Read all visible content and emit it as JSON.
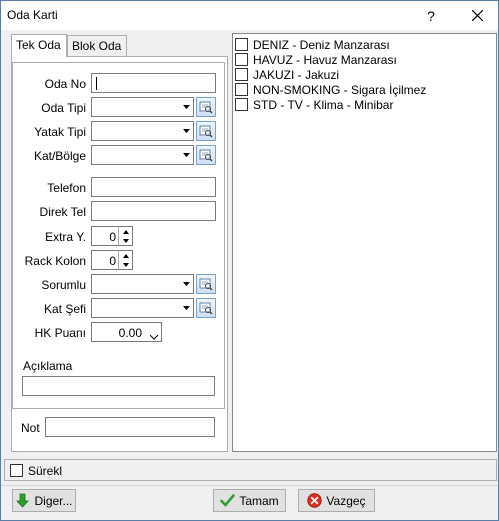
{
  "window": {
    "title": "Oda Karti",
    "help_label": "?"
  },
  "tabs": [
    {
      "label": "Tek Oda",
      "active": true
    },
    {
      "label": "Blok Oda",
      "active": false
    }
  ],
  "form": {
    "oda_no": {
      "label": "Oda No",
      "value": ""
    },
    "oda_tipi": {
      "label": "Oda Tipi",
      "value": ""
    },
    "yatak_tipi": {
      "label": "Yatak Tipi",
      "value": ""
    },
    "kat_bolge": {
      "label": "Kat/Bölge",
      "value": ""
    },
    "telefon": {
      "label": "Telefon",
      "value": ""
    },
    "direk_tel": {
      "label": "Direk Tel",
      "value": ""
    },
    "extra_y": {
      "label": "Extra Y.",
      "value": "0"
    },
    "rack_kolon": {
      "label": "Rack Kolon",
      "value": "0"
    },
    "sorumlu": {
      "label": "Sorumlu",
      "value": ""
    },
    "kat_sefi": {
      "label": "Kat Şefi",
      "value": ""
    },
    "hk_puani": {
      "label": "HK Puanı",
      "value": "0.00"
    },
    "aciklama": {
      "label": "Açıklama",
      "value": ""
    },
    "not": {
      "label": "Not",
      "value": ""
    }
  },
  "features": [
    {
      "label": "DENIZ - Deniz Manzarası",
      "checked": false
    },
    {
      "label": "HAVUZ - Havuz Manzarası",
      "checked": false
    },
    {
      "label": "JAKUZI - Jakuzi",
      "checked": false
    },
    {
      "label": "NON-SMOKING - Sigara İçilmez",
      "checked": false
    },
    {
      "label": "STD - TV - Klima - Minibar",
      "checked": false
    }
  ],
  "surekli": {
    "label": "Sürekl",
    "checked": false
  },
  "buttons": {
    "diger": "Diger...",
    "tamam": "Tamam",
    "vazgec": "Vazgeç"
  },
  "colors": {
    "accent_green": "#2e9e2e",
    "cancel_red": "#d93025",
    "lookup_blue": "#7aa0d0"
  }
}
